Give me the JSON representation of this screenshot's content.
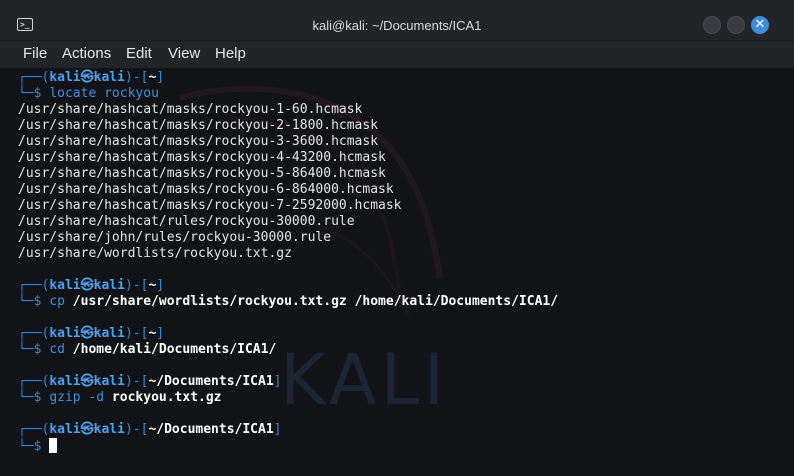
{
  "window": {
    "title": "kali@kali: ~/Documents/ICA1",
    "terminal_icon": "terminal-icon",
    "close_glyph": "✕"
  },
  "menu": {
    "file": "File",
    "actions": "Actions",
    "edit": "Edit",
    "view": "View",
    "help": "Help"
  },
  "background": {
    "watermark": "KALI"
  },
  "terminal": {
    "prompt_start": "┌──(",
    "user": "kali",
    "at_symbol": "㉿",
    "host": "kali",
    "prompt_mid": ")-[",
    "prompt_end": "]",
    "prompt_line2": "└─$ ",
    "blocks": [
      {
        "path": "~",
        "command": "locate",
        "argument": " rockyou",
        "output": [
          "/usr/share/hashcat/masks/rockyou-1-60.hcmask",
          "/usr/share/hashcat/masks/rockyou-2-1800.hcmask",
          "/usr/share/hashcat/masks/rockyou-3-3600.hcmask",
          "/usr/share/hashcat/masks/rockyou-4-43200.hcmask",
          "/usr/share/hashcat/masks/rockyou-5-86400.hcmask",
          "/usr/share/hashcat/masks/rockyou-6-864000.hcmask",
          "/usr/share/hashcat/masks/rockyou-7-2592000.hcmask",
          "/usr/share/hashcat/rules/rockyou-30000.rule",
          "/usr/share/john/rules/rockyou-30000.rule",
          "/usr/share/wordlists/rockyou.txt.gz"
        ]
      },
      {
        "path": "~",
        "command": "cp",
        "argument": " /usr/share/wordlists/rockyou.txt.gz /home/kali/Documents/ICA1/"
      },
      {
        "path": "~",
        "command": "cd",
        "argument": " /home/kali/Documents/ICA1/"
      },
      {
        "path": "~/Documents/ICA1",
        "command": "gzip -d",
        "argument": " rockyou.txt.gz"
      },
      {
        "path": "~/Documents/ICA1",
        "command": "",
        "argument": ""
      }
    ]
  },
  "colors": {
    "prompt_frame": "#2f88d8",
    "user_host": "#4aa3f0",
    "accent_close": "#3d8bd9",
    "background": "#121316"
  }
}
